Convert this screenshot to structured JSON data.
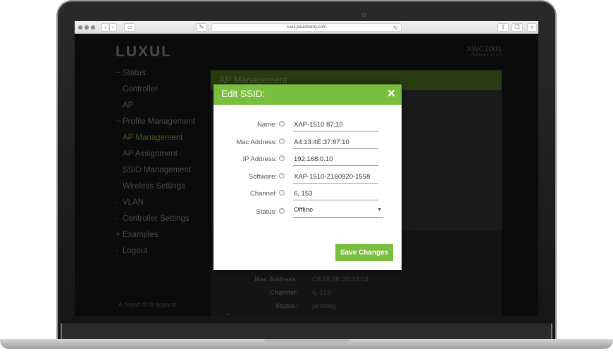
{
  "browser": {
    "url": "luxul.paulshorey.com"
  },
  "app": {
    "logo": "LUXUL",
    "device_name": "XWC1001",
    "device_sub": "Firmware v0.0.0",
    "brand_footer": "A brand of ⧉ legrand"
  },
  "nav": [
    {
      "label": "Status",
      "marker": "−"
    },
    {
      "label": "Controller",
      "marker": ""
    },
    {
      "label": "AP",
      "marker": ""
    },
    {
      "label": "Profile Management",
      "marker": "−"
    },
    {
      "label": "AP Management",
      "marker": ""
    },
    {
      "label": "AP Assignment",
      "marker": ""
    },
    {
      "label": "SSID Management",
      "marker": ""
    },
    {
      "label": "Wireless Settings",
      "marker": ""
    },
    {
      "label": "VLAN",
      "marker": "·"
    },
    {
      "label": "Controller Settings",
      "marker": "·"
    },
    {
      "label": "Examples",
      "marker": "+"
    },
    {
      "label": "Logout",
      "marker": "·"
    }
  ],
  "panel": {
    "title": "AP Management",
    "bg_rows": [
      {
        "label": "Mac Address:",
        "value": "C8:26:9R:35:23:04"
      },
      {
        "label": "Channel:",
        "value": "6, 153"
      },
      {
        "label": "Status:",
        "value": "pending"
      }
    ]
  },
  "modal": {
    "title": "Edit SSID:",
    "close_icon": "×",
    "fields": [
      {
        "label": "Name:",
        "value": "XAP-1510 87:10"
      },
      {
        "label": "Mac Address:",
        "value": "A4:13:4E:37:87:10"
      },
      {
        "label": "IP Address:",
        "value": "192.168.0.10"
      },
      {
        "label": "Software:",
        "value": "XAP-1510-Z160920-1558"
      },
      {
        "label": "Channel:",
        "value": "6, 153"
      }
    ],
    "status": {
      "label": "Status:",
      "value": "Offline"
    },
    "save_label": "Save Changes"
  },
  "colors": {
    "accent": "#79be3e",
    "accent_dim": "#2a3d10"
  }
}
